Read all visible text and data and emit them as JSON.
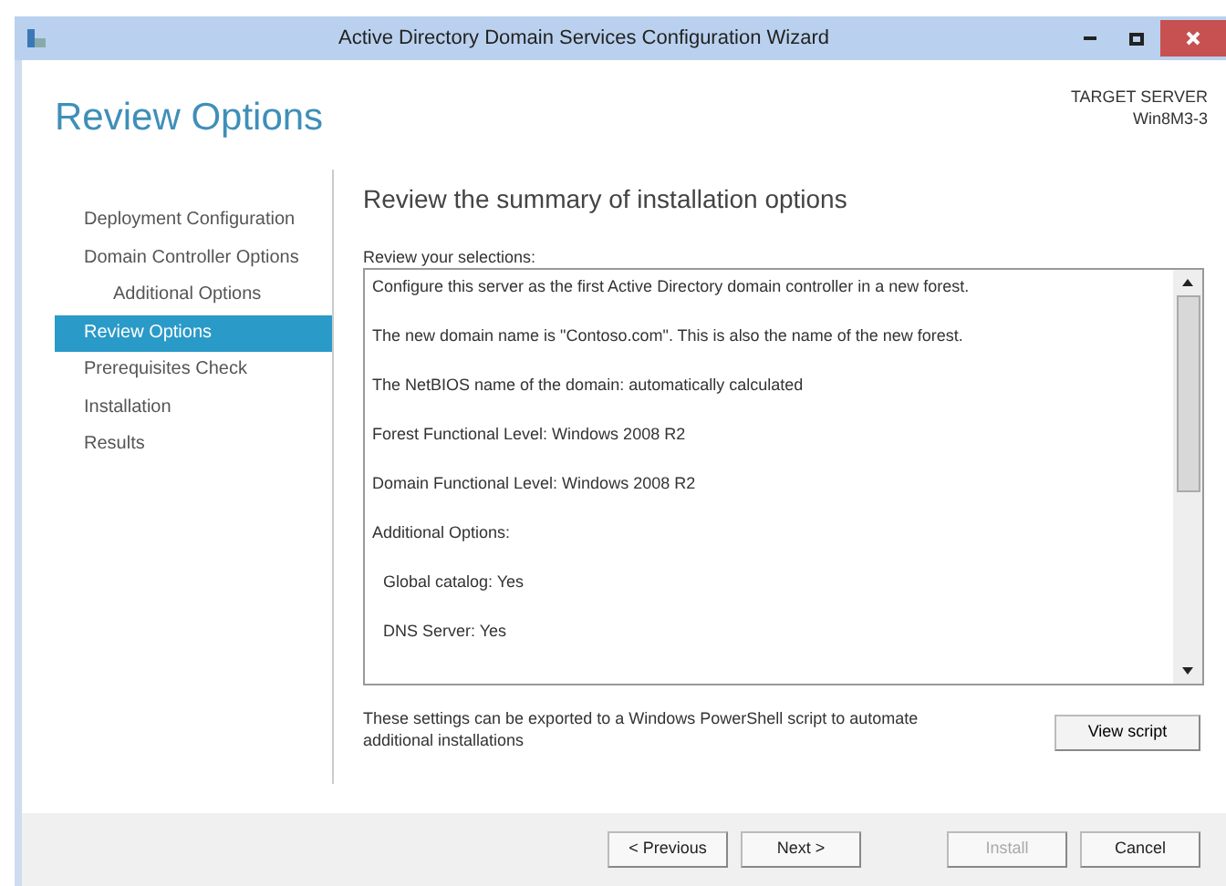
{
  "window": {
    "title": "Active Directory Domain Services Configuration Wizard"
  },
  "header": {
    "title": "Review Options",
    "target_label": "TARGET SERVER",
    "target_name": "Win8M3-3"
  },
  "sidebar": {
    "items": [
      {
        "label": "Deployment Configuration",
        "selected": false
      },
      {
        "label": "Domain Controller Options",
        "selected": false,
        "children": [
          {
            "label": "Additional Options",
            "selected": false
          }
        ]
      },
      {
        "label": "Review Options",
        "selected": true
      },
      {
        "label": "Prerequisites Check",
        "selected": false
      },
      {
        "label": "Installation",
        "selected": false
      },
      {
        "label": "Results",
        "selected": false
      }
    ]
  },
  "main": {
    "heading": "Review the summary of installation options",
    "list_label": "Review your selections:",
    "selections": [
      {
        "text": "Configure this server as the first Active Directory domain controller in a new forest.",
        "indented": false
      },
      {
        "text": "The new domain name is \"Contoso.com\". This is also the name of the new forest.",
        "indented": false
      },
      {
        "text": "The NetBIOS name of the domain: automatically calculated",
        "indented": false
      },
      {
        "text": "Forest Functional Level: Windows 2008 R2",
        "indented": false
      },
      {
        "text": "Domain Functional Level: Windows 2008 R2",
        "indented": false
      },
      {
        "text": "Additional Options:",
        "indented": false
      },
      {
        "text": "Global catalog: Yes",
        "indented": true
      },
      {
        "text": "DNS Server: Yes",
        "indented": true
      }
    ],
    "export_note": "These settings can be exported to a Windows PowerShell script to automate additional installations",
    "view_script": "View script"
  },
  "buttons": [
    {
      "label": "< Previous",
      "disabled": false
    },
    {
      "label": "Next >",
      "disabled": false
    },
    {
      "label": "Install",
      "disabled": true
    },
    {
      "label": "Cancel",
      "disabled": false
    }
  ]
}
